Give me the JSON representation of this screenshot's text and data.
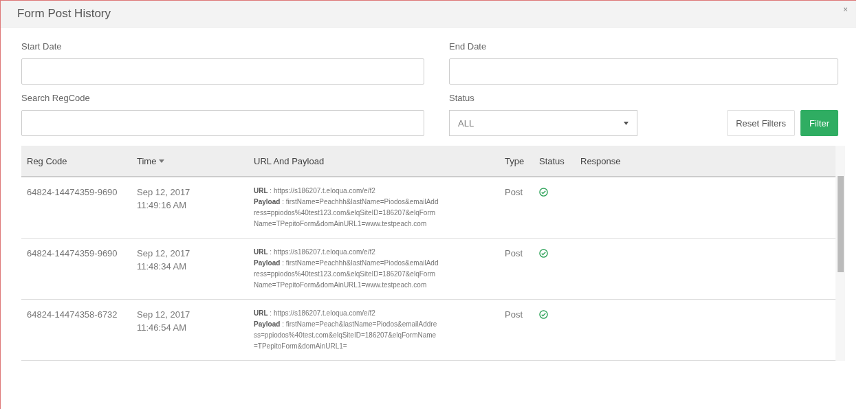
{
  "window": {
    "title": "Form Post History",
    "close": "×"
  },
  "filters": {
    "start_date": {
      "label": "Start Date"
    },
    "end_date": {
      "label": "End Date"
    },
    "search": {
      "label": "Search RegCode"
    },
    "status": {
      "label": "Status",
      "value": "ALL"
    },
    "buttons": [
      "Reset Filters",
      "Filter"
    ]
  },
  "table": {
    "columns": [
      {
        "label": "Reg Code",
        "sorted": false
      },
      {
        "label": "Time",
        "sorted": true
      },
      {
        "label": "URL And Payload",
        "sorted": false
      },
      {
        "label": "Type",
        "sorted": false
      },
      {
        "label": "Status",
        "sorted": false
      },
      {
        "label": "Response",
        "sorted": false
      }
    ],
    "rows": [
      {
        "reg_code": "64824-14474359-9690",
        "date": "Sep 12, 2017",
        "time": "11:49:16 AM",
        "url_label": "URL",
        "url": ": https://s186207.t.eloqua.com/e/f2",
        "payload_label": "Payload",
        "payload": ": firstName=Peachhh&lastName=Piodos&emailAddress=ppiodos%40test123.com&elqSiteID=186207&elqFormName=TPepitoForm&domAinURL1=www.testpeach.com",
        "type": "Post",
        "kind": "success"
      },
      {
        "reg_code": "64824-14474359-9690",
        "date": "Sep 12, 2017",
        "time": "11:48:34 AM",
        "url_label": "URL",
        "url": ": https://s186207.t.eloqua.com/e/f2",
        "payload_label": "Payload",
        "payload": ": firstName=Peachhh&lastName=Piodos&emailAddress=ppiodos%40test123.com&elqSiteID=186207&elqFormName=TPepitoForm&domAinURL1=www.testpeach.com",
        "type": "Post",
        "kind": "success"
      },
      {
        "reg_code": "64824-14474358-6732",
        "date": "Sep 12, 2017",
        "time": "11:46:54 AM",
        "url_label": "URL",
        "url": ": https://s186207.t.eloqua.com/e/f2",
        "payload_label": "Payload",
        "payload": ": firstName=Peach&lastName=Piodos&emailAddress=ppiodos%40test.com&elqSiteID=186207&elqFormName=TPepitoForm&domAinURL1=",
        "type": "Post",
        "kind": "success"
      }
    ]
  }
}
